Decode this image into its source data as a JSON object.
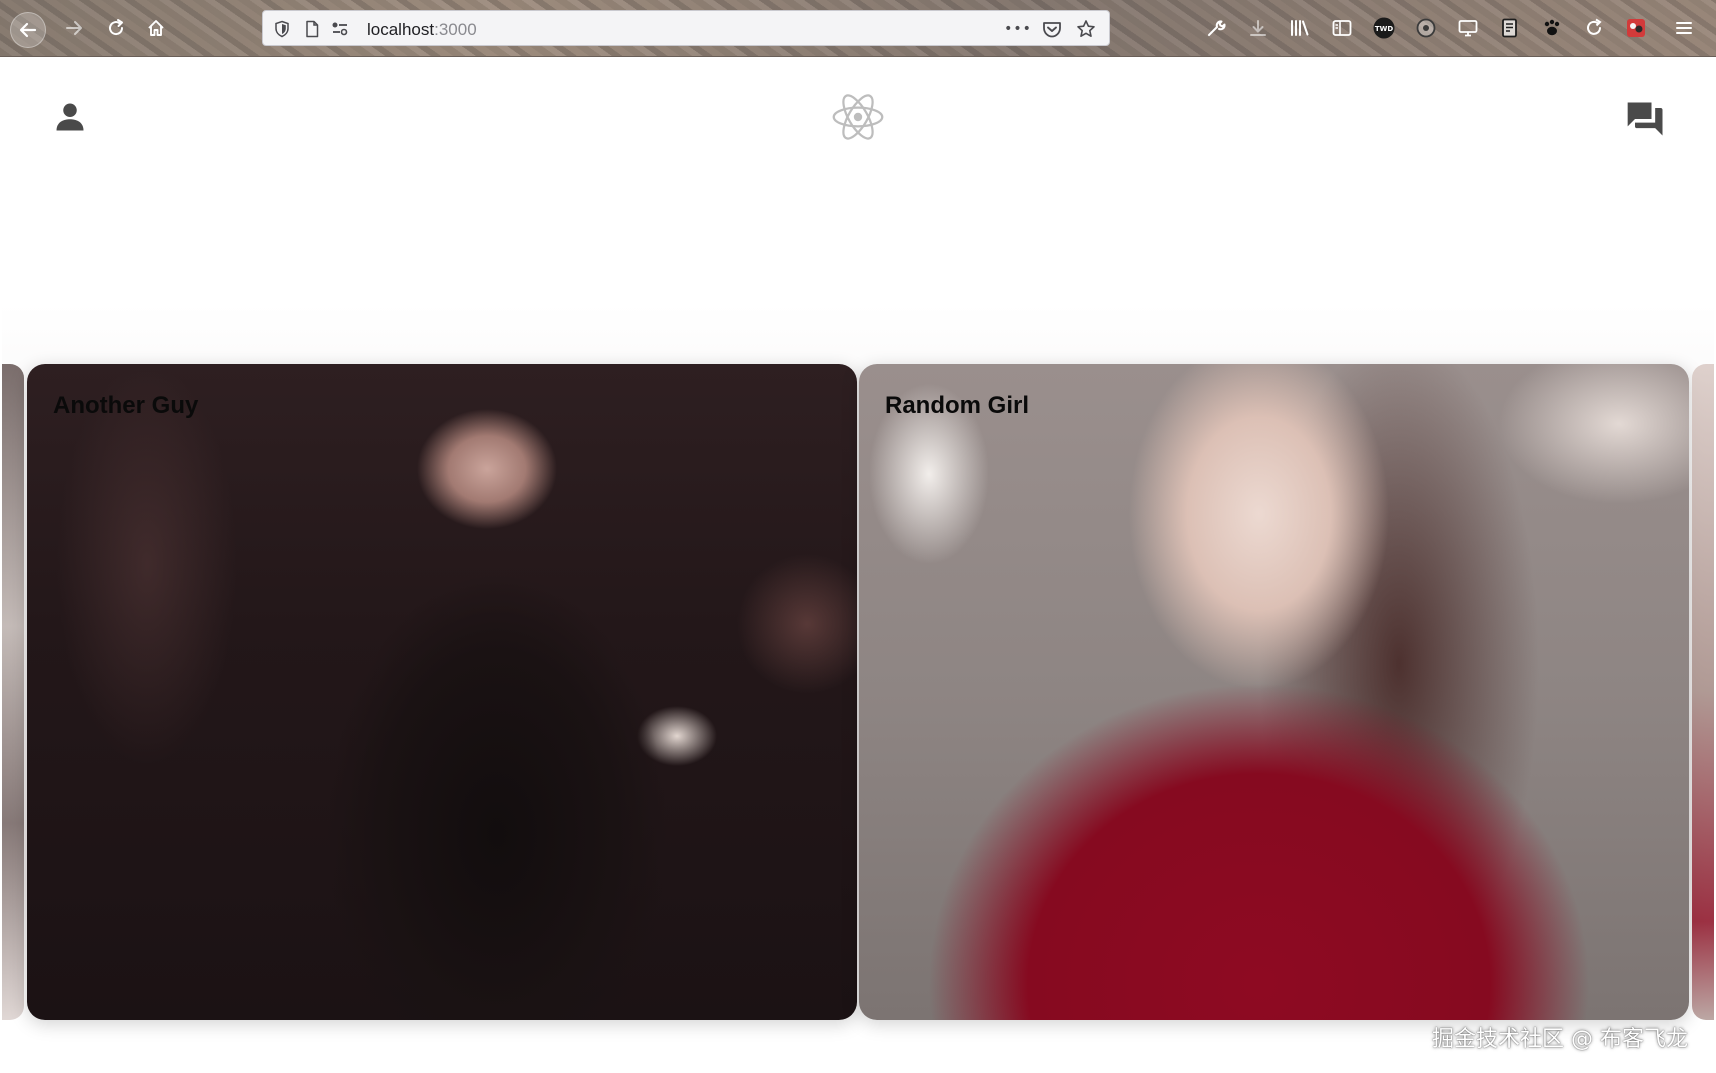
{
  "browser": {
    "url_host": "localhost",
    "url_port": ":3000",
    "back_icon": "arrow-left-icon",
    "forward_icon": "arrow-right-icon",
    "reload_icon": "reload-icon",
    "home_icon": "home-icon",
    "more_label": "•••",
    "accent_color": "#202024"
  },
  "header": {
    "profile_icon": "person-icon",
    "logo_icon": "react-atom-icon",
    "chat_icon": "forum-icon",
    "icon_color": "#4a4a4a"
  },
  "cards": [
    {
      "name": "Another Guy"
    },
    {
      "name": "Random Girl"
    }
  ],
  "watermark": "掘金技术社区 @ 布客飞龙"
}
